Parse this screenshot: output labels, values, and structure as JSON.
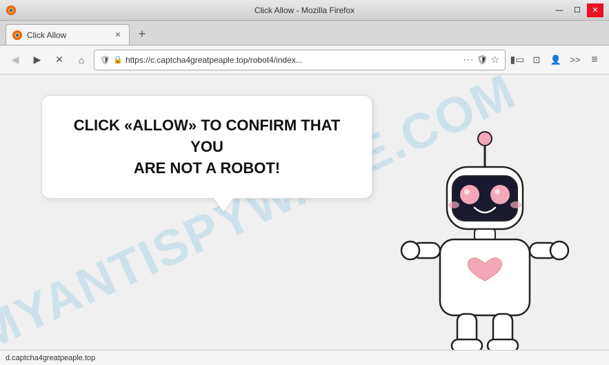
{
  "titlebar": {
    "title": "Click Allow - Mozilla Firefox",
    "tab_label": "Click Allow",
    "minimize_label": "—",
    "maximize_label": "☐",
    "close_label": "✕"
  },
  "addressbar": {
    "url": "https://c.captcha4greatpeaple.top/robot4/index...",
    "lock_icon": "🔒"
  },
  "page": {
    "main_text_line1": "CLICK «ALLOW» TO CONFIRM THAT YOU",
    "main_text_line2": "ARE NOT A ROBOT!",
    "watermark": "MYANTISPYWARE.COM",
    "new_tab_icon": "+",
    "back_icon": "←",
    "forward_icon": "→",
    "reload_icon": "✕",
    "home_icon": "⌂",
    "menu_icon": "≡",
    "bookmark_icon": "☆",
    "more_icon": "…"
  },
  "statusbar": {
    "text": "d.captcha4greatpeaple.top"
  }
}
